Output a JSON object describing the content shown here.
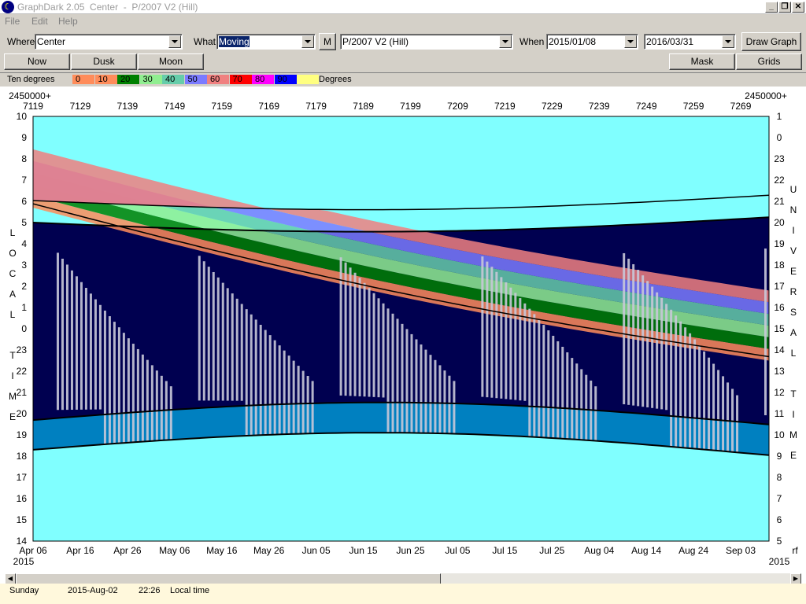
{
  "window": {
    "title": "GraphDark 2.05  Center  -  P/2007 V2 (Hill)",
    "minimize_label": "_",
    "restore_label": "❐",
    "close_label": "✕"
  },
  "menu": {
    "items": [
      "File",
      "Edit",
      "Help"
    ]
  },
  "toolbar": {
    "where_label": "Where",
    "where_value": "Center",
    "what_label": "What",
    "what_value": "Moving",
    "m_button": "M",
    "object_value": "P/2007 V2 (Hill)",
    "when_label": "When",
    "start_date": "2015/01/08",
    "end_date": "2016/03/31",
    "draw_button": "Draw Graph"
  },
  "nav": {
    "now": "Now",
    "dusk": "Dusk",
    "moon": "Moon",
    "mask": "Mask",
    "grids": "Grids"
  },
  "legend": {
    "title": "Ten degrees",
    "suffix": "Degrees",
    "entries": [
      {
        "label": "0",
        "color": "#ff8c5a"
      },
      {
        "label": "10",
        "color": "#ff8c5a"
      },
      {
        "label": "20",
        "color": "#008000"
      },
      {
        "label": "30",
        "color": "#90ee90"
      },
      {
        "label": "40",
        "color": "#66cdaa"
      },
      {
        "label": "50",
        "color": "#7b7bff"
      },
      {
        "label": "60",
        "color": "#f08080"
      },
      {
        "label": "70",
        "color": "#ff0000"
      },
      {
        "label": "80",
        "color": "#ff00ff"
      },
      {
        "label": "90",
        "color": "#0000ff"
      },
      {
        "label": "",
        "color": "#ffff80"
      }
    ]
  },
  "chart_data": {
    "type": "area",
    "jd_prefix_left": "2450000+",
    "jd_prefix_right": "2450000+",
    "jd_ticks": [
      "7119",
      "7129",
      "7139",
      "7149",
      "7159",
      "7169",
      "7179",
      "7189",
      "7199",
      "7209",
      "7219",
      "7229",
      "7239",
      "7249",
      "7259",
      "7269"
    ],
    "date_ticks": [
      "Apr 06",
      "Apr 16",
      "Apr 26",
      "May 06",
      "May 16",
      "May 26",
      "Jun 05",
      "Jun 15",
      "Jun 25",
      "Jul 05",
      "Jul 15",
      "Jul 25",
      "Aug 04",
      "Aug 14",
      "Aug 24",
      "Sep 03"
    ],
    "year_left": "2015",
    "year_right": "2015",
    "right_corner_label": "rf",
    "left_axis_label": "LOCAL TIME",
    "right_axis_label": "UNIVERSAL TIME",
    "local_hours": [
      "10",
      "9",
      "8",
      "7",
      "6",
      "5",
      "4",
      "3",
      "2",
      "1",
      "0",
      "23",
      "22",
      "21",
      "20",
      "19",
      "18",
      "17",
      "16",
      "15",
      "14"
    ],
    "ut_hours": [
      "1",
      "0",
      "23",
      "22",
      "21",
      "20",
      "19",
      "18",
      "17",
      "16",
      "15",
      "14",
      "13",
      "12",
      "11",
      "10",
      "9",
      "8",
      "7",
      "6",
      "5"
    ],
    "sky_color": "#80ffff",
    "night_color": "#000050",
    "twilight_color": "#0080c0",
    "moon_color": "#c8c8d8"
  },
  "status": {
    "day": "Sunday",
    "date": "2015-Aug-02",
    "time": "22:26",
    "mode": "Local time",
    "scroll_left": "◀",
    "scroll_right": "▶"
  }
}
